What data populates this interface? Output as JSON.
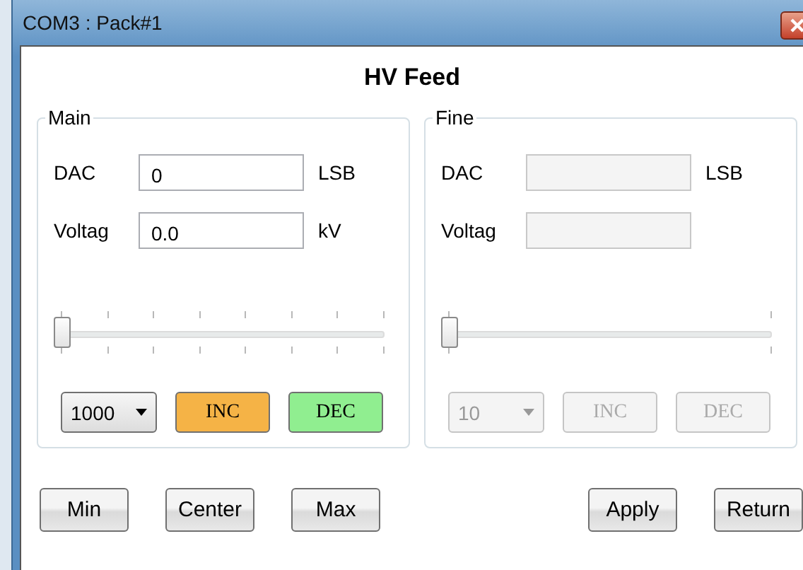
{
  "window": {
    "title": "COM3  : Pack#1"
  },
  "heading": "HV Feed",
  "groups": [
    {
      "title": "Main",
      "disabled": false,
      "dac": {
        "label": "DAC",
        "value": "0",
        "unit": "LSB"
      },
      "voltage": {
        "label": "Voltag",
        "value": "0.0",
        "unit": "kV"
      },
      "slider": {
        "level": 0,
        "kind": "steps"
      },
      "step": "1000",
      "buttons": [
        {
          "label": "INC",
          "color": "#f5b346"
        },
        {
          "label": "DEC",
          "color": "#90ee90"
        }
      ]
    },
    {
      "title": "Fine",
      "disabled": true,
      "dac": {
        "label": "DAC",
        "unit": "LSB"
      },
      "voltage": {
        "label": "Voltag"
      },
      "slider": {
        "level": 0,
        "kind": "ends"
      },
      "step": "10",
      "buttons": [
        {
          "label": "INC"
        },
        {
          "label": "DEC"
        }
      ]
    }
  ],
  "left_buttons": [
    "Min",
    "Center",
    "Max"
  ],
  "right_buttons": [
    "Apply",
    "Return"
  ]
}
